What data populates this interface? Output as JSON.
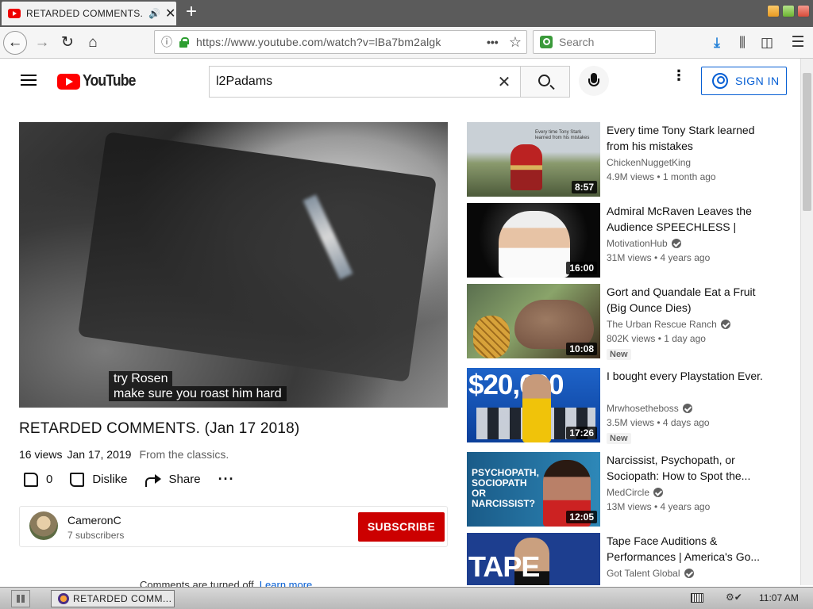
{
  "browser": {
    "tab_title": "RETARDED COMMENTS. (",
    "url": "https://www.youtube.com/watch?v=lBa7bm2algk",
    "search_placeholder": "Search"
  },
  "header": {
    "logo_text": "YouTube",
    "search_query": "l2Padams",
    "signin_label": "SIGN IN"
  },
  "video": {
    "caption_line1": "try Rosen",
    "caption_line2": "make sure you roast him hard",
    "title": "RETARDED COMMENTS. (Jan 17 2018)",
    "views": "16 views",
    "date": "Jan 17, 2019",
    "description": "From the classics.",
    "likes": "0",
    "dislike_label": "Dislike",
    "share_label": "Share"
  },
  "channel": {
    "name": "CameronC",
    "subscribers": "7 subscribers",
    "subscribe_label": "SUBSCRIBE"
  },
  "comments": {
    "notice": "Comments are turned off.",
    "link": "Learn more"
  },
  "recommendations": [
    {
      "title": "Every time Tony Stark learned from his mistakes",
      "channel": "ChickenNuggetKing",
      "verified": false,
      "views": "4.9M views • 1 month ago",
      "duration": "8:57",
      "badge": "",
      "thumb_text": "Every time Tony Stark learned from his mistakes"
    },
    {
      "title": "Admiral McRaven Leaves the Audience SPEECHLESS | One...",
      "channel": "MotivationHub",
      "verified": true,
      "views": "31M views • 4 years ago",
      "duration": "16:00",
      "badge": ""
    },
    {
      "title": "Gort and Quandale Eat a Fruit (Big Ounce Dies)",
      "channel": "The Urban Rescue Ranch",
      "verified": true,
      "views": "802K views • 1 day ago",
      "duration": "10:08",
      "badge": "New"
    },
    {
      "title": "I bought every Playstation Ever.",
      "channel": "Mrwhosetheboss",
      "verified": true,
      "views": "3.5M views • 4 days ago",
      "duration": "17:26",
      "badge": "New",
      "thumb_text": "$20,000"
    },
    {
      "title": "Narcissist, Psychopath, or Sociopath: How to Spot the...",
      "channel": "MedCircle",
      "verified": true,
      "views": "13M views • 4 years ago",
      "duration": "12:05",
      "badge": "",
      "thumb_text": "PSYCHOPATH, SOCIOPATH OR NARCISSIST?"
    },
    {
      "title": "Tape Face Auditions & Performances | America's Go...",
      "channel": "Got Talent Global",
      "verified": true,
      "views": "",
      "duration": "",
      "badge": "",
      "thumb_text": "TAPE FACE"
    }
  ],
  "taskbar": {
    "item_label": "RETARDED COMM...",
    "clock": "11:07 AM"
  }
}
